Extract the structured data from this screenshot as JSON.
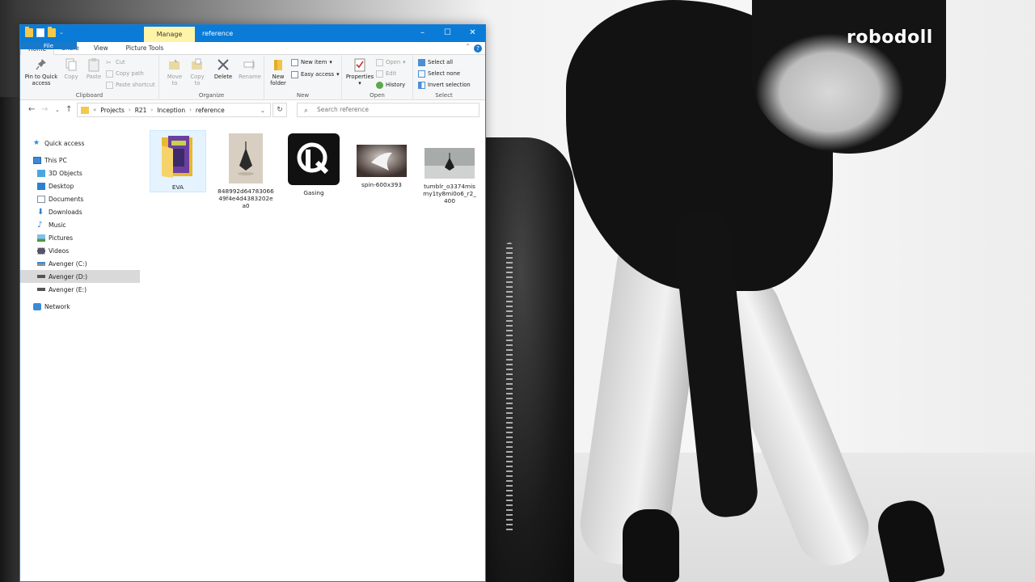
{
  "wallpaper": {
    "watermark": "robodoll"
  },
  "window": {
    "title_tab": "Manage",
    "title": "reference",
    "controls": {
      "minimize": "–",
      "maximize": "☐",
      "close": "✕"
    }
  },
  "tabs": [
    "File",
    "Home",
    "Share",
    "View",
    "Picture Tools"
  ],
  "ribbon": {
    "clipboard": {
      "label": "Clipboard",
      "pin": "Pin to Quick access",
      "pin_l1": "Pin to Quick",
      "pin_l2": "access",
      "copy": "Copy",
      "paste": "Paste",
      "cut": "Cut",
      "copy_path": "Copy path",
      "paste_shortcut": "Paste shortcut"
    },
    "organize": {
      "label": "Organize",
      "move_l1": "Move",
      "move_l2": "to",
      "copy_l1": "Copy",
      "copy_l2": "to",
      "delete": "Delete",
      "rename": "Rename"
    },
    "new": {
      "label": "New",
      "new_item": "New item",
      "easy_access": "Easy access",
      "folder_l1": "New",
      "folder_l2": "folder"
    },
    "open": {
      "label": "Open",
      "properties": "Properties",
      "open": "Open",
      "edit": "Edit",
      "history": "History"
    },
    "select": {
      "label": "Select",
      "select_all": "Select all",
      "select_none": "Select none",
      "invert": "Invert selection"
    }
  },
  "address": {
    "crumbs": [
      "Projects",
      "R21",
      "Inception",
      "reference"
    ],
    "search_placeholder": "Search reference"
  },
  "nav": {
    "quick_access": "Quick access",
    "this_pc": "This PC",
    "items": [
      "3D Objects",
      "Desktop",
      "Documents",
      "Downloads",
      "Music",
      "Pictures",
      "Videos",
      "Avenger (C:)",
      "Avenger (D:)",
      "Avenger (E:)"
    ],
    "network": "Network"
  },
  "files": [
    {
      "name": "EVA"
    },
    {
      "name_l1": "848992d64783066",
      "name_l2": "49f4e4d4383202e",
      "name_l3": "a0"
    },
    {
      "name": "Gasing"
    },
    {
      "name": "spin-600x393"
    },
    {
      "name_l1": "tumblr_o3374mis",
      "name_l2": "my1ty8mi0o6_r2_",
      "name_l3": "400"
    }
  ],
  "colors": {
    "titlebar": "#0a7bd7",
    "file_tab": "#1979ca",
    "manage_tab": "#fff3a8",
    "selection": "#d9d9d9"
  }
}
